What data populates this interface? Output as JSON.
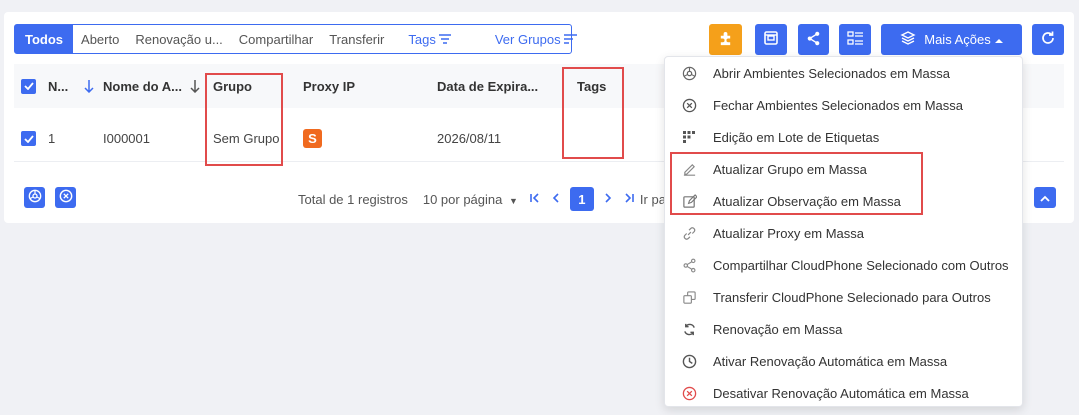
{
  "tabs": [
    {
      "label": "Todos"
    },
    {
      "label": "Aberto"
    },
    {
      "label": "Renovação u..."
    },
    {
      "label": "Compartilhar"
    },
    {
      "label": "Transferir"
    }
  ],
  "tags_tab": "Tags",
  "groups_tab": "Ver Grupos",
  "toolbar": {
    "more_actions": "Mais Ações",
    "colors": {
      "accent": "#3d6bf0",
      "plugin": "#f5a01a"
    }
  },
  "table": {
    "headers": {
      "no": "N...",
      "name": "Nome do A...",
      "group": "Grupo",
      "proxy": "Proxy IP",
      "expiry": "Data de Expira...",
      "tags": "Tags"
    },
    "rows": [
      {
        "no": "1",
        "name": "I000001",
        "group": "Sem Grupo",
        "proxy_badge": "S",
        "expiry": "2026/08/11",
        "tags": ""
      }
    ]
  },
  "footer": {
    "total": "Total de 1 registros",
    "per_page": "10 por página",
    "current_page": "1",
    "goto": "Ir pa"
  },
  "menu": [
    {
      "label": "Abrir Ambientes Selecionados em Massa",
      "icon": "chrome-icon"
    },
    {
      "label": "Fechar Ambientes Selecionados em Massa",
      "icon": "close-circle-icon"
    },
    {
      "label": "Edição em Lote de Etiquetas",
      "icon": "tags-icon"
    },
    {
      "label": "Atualizar Grupo em Massa",
      "icon": "folder-edit-icon"
    },
    {
      "label": "Atualizar Observação em Massa",
      "icon": "edit-icon"
    },
    {
      "label": "Atualizar Proxy em Massa",
      "icon": "link-icon"
    },
    {
      "label": "Compartilhar CloudPhone Selecionado com Outros",
      "icon": "share-icon"
    },
    {
      "label": "Transferir CloudPhone Selecionado para Outros",
      "icon": "transfer-icon"
    },
    {
      "label": "Renovação em Massa",
      "icon": "refresh-icon"
    },
    {
      "label": "Ativar Renovação Automática em Massa",
      "icon": "clock-icon"
    },
    {
      "label": "Desativar Renovação Automática em Massa",
      "icon": "stop-circle-icon"
    }
  ]
}
